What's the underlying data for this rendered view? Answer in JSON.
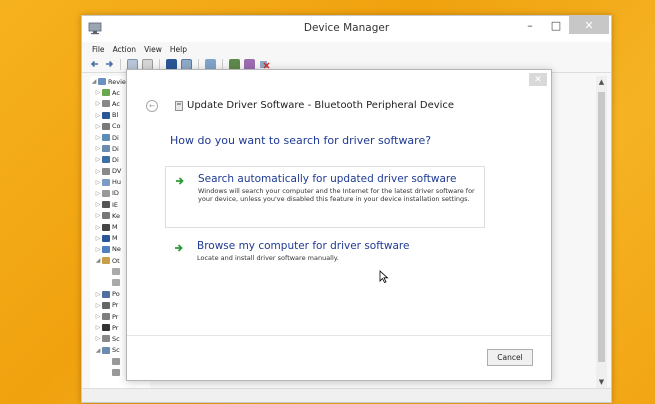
{
  "window": {
    "title": "Device Manager",
    "controls": {
      "minimize": "–",
      "maximize": "□",
      "close": "✕"
    }
  },
  "menu": [
    "File",
    "Action",
    "View",
    "Help"
  ],
  "tree": {
    "items": [
      {
        "expander": "◢",
        "label": "Revie",
        "color": "#6b8fbf"
      },
      {
        "expander": "▷",
        "label": "Ac",
        "color": "#6aa84f"
      },
      {
        "expander": "▷",
        "label": "Ac",
        "color": "#888888"
      },
      {
        "expander": "▷",
        "label": "Bl",
        "color": "#2b5797"
      },
      {
        "expander": "▷",
        "label": "Co",
        "color": "#7a7a7a"
      },
      {
        "expander": "▷",
        "label": "Di",
        "color": "#5b8db8"
      },
      {
        "expander": "▷",
        "label": "Di",
        "color": "#6a8caf"
      },
      {
        "expander": "▷",
        "label": "Di",
        "color": "#3d6ea5"
      },
      {
        "expander": "▷",
        "label": "DV",
        "color": "#8a8a8a"
      },
      {
        "expander": "▷",
        "label": "Hu",
        "color": "#7a9cc6"
      },
      {
        "expander": "▷",
        "label": "ID",
        "color": "#999999"
      },
      {
        "expander": "▷",
        "label": "IE",
        "color": "#555555"
      },
      {
        "expander": "▷",
        "label": "Ke",
        "color": "#777777"
      },
      {
        "expander": "▷",
        "label": "M",
        "color": "#444444"
      },
      {
        "expander": "▷",
        "label": "M",
        "color": "#2b5797"
      },
      {
        "expander": "▷",
        "label": "Ne",
        "color": "#4f81bd"
      },
      {
        "expander": "◢",
        "label": "Ot",
        "color": "#c9a04a"
      },
      {
        "expander": "",
        "label": "",
        "color": "#aaaaaa"
      },
      {
        "expander": "",
        "label": "",
        "color": "#aaaaaa"
      },
      {
        "expander": "▷",
        "label": "Po",
        "color": "#4f6fa0"
      },
      {
        "expander": "▷",
        "label": "Pr",
        "color": "#666666"
      },
      {
        "expander": "▷",
        "label": "Pr",
        "color": "#7f7f7f"
      },
      {
        "expander": "▷",
        "label": "Pr",
        "color": "#333333"
      },
      {
        "expander": "▷",
        "label": "Sc",
        "color": "#8a8a8a"
      },
      {
        "expander": "◢",
        "label": "Sc",
        "color": "#6a8caf"
      },
      {
        "expander": "",
        "label": "",
        "color": "#999999"
      },
      {
        "expander": "",
        "label": "",
        "color": "#999999"
      }
    ]
  },
  "dialog": {
    "title": "Update Driver Software - Bluetooth Peripheral Device",
    "question": "How do you want to search for driver software?",
    "option_search": {
      "title": "Search automatically for updated driver software",
      "description": "Windows will search your computer and the Internet for the latest driver software for your device, unless you've disabled this feature in your device installation settings."
    },
    "option_browse": {
      "title": "Browse my computer for driver software",
      "description": "Locate and install driver software manually."
    },
    "cancel_label": "Cancel",
    "close_glyph": "✕",
    "back_glyph": "←"
  },
  "scrollbar": {
    "up": "▲",
    "down": "▼"
  },
  "colors": {
    "accent_link": "#1f3a93",
    "arrow_green": "#2e9b3a",
    "desktop": "#f3a20d"
  }
}
